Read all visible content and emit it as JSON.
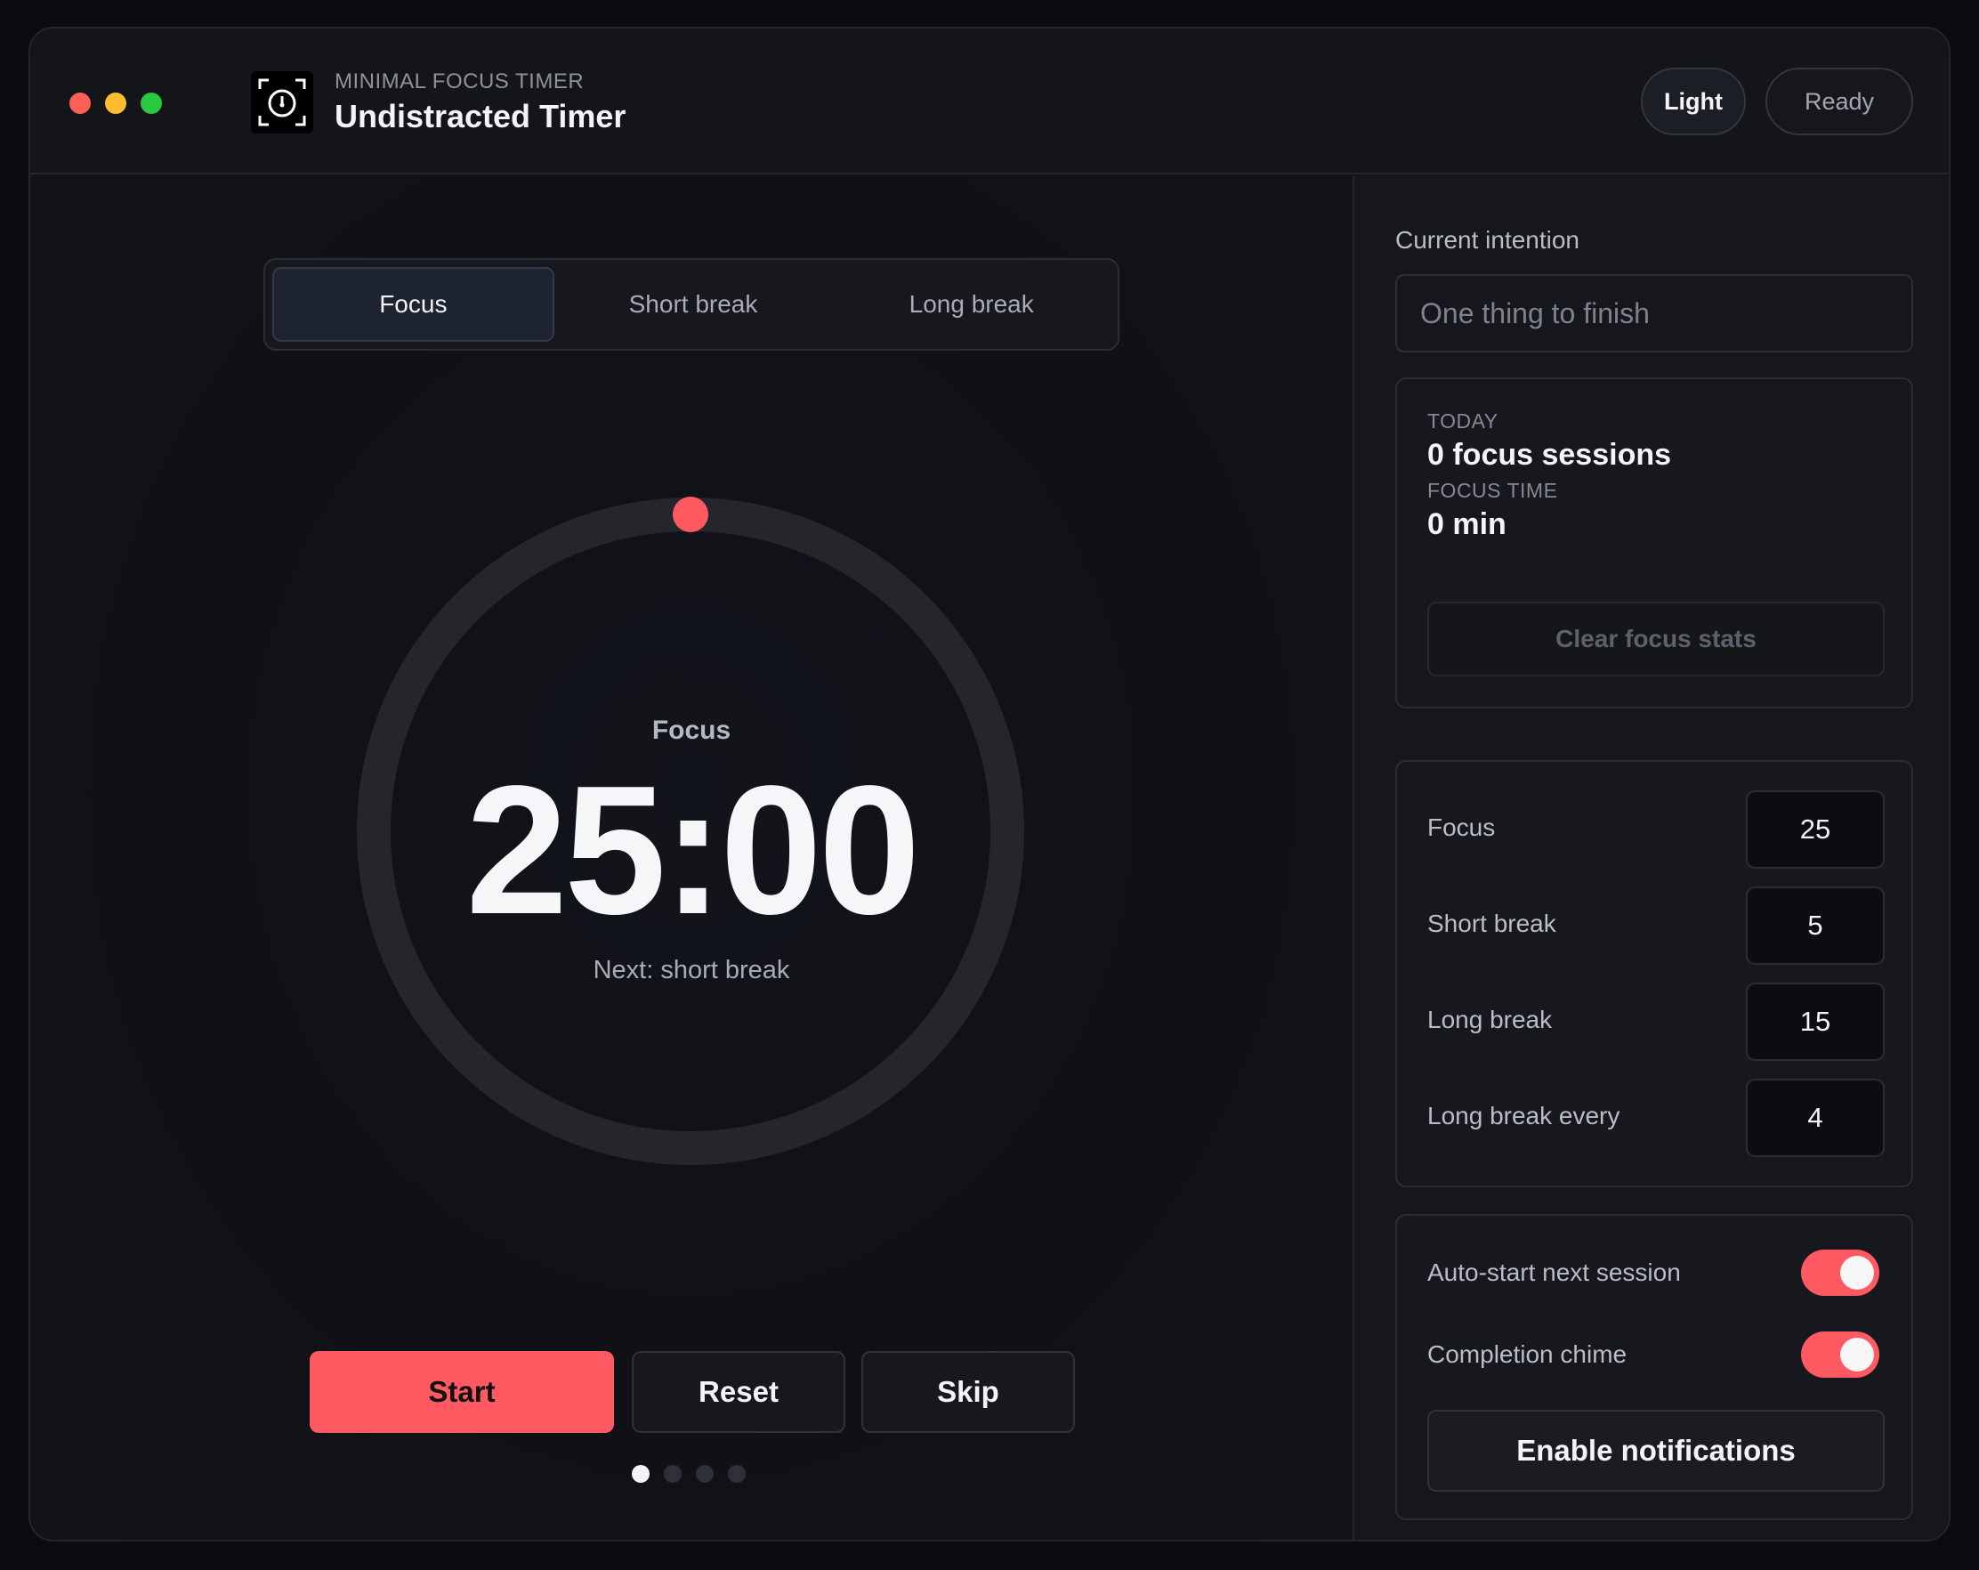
{
  "window": {
    "subtitle": "MINIMAL FOCUS TIMER",
    "title": "Undistracted Timer",
    "traffic_lights": [
      "#ff5f57",
      "#febc2e",
      "#28c840"
    ],
    "theme_button": "Light",
    "status": "Ready"
  },
  "modes": {
    "items": [
      {
        "label": "Focus",
        "active": true
      },
      {
        "label": "Short break",
        "active": false
      },
      {
        "label": "Long break",
        "active": false
      }
    ]
  },
  "timer": {
    "mode_label": "Focus",
    "time": "25:00",
    "next": "Next: short break",
    "progress": 0,
    "accent": "#ff5a62"
  },
  "controls": {
    "start": "Start",
    "reset": "Reset",
    "skip": "Skip"
  },
  "cycle": {
    "total": 4,
    "current": 1
  },
  "sidebar": {
    "intention_label": "Current intention",
    "intention_placeholder": "One thing to finish",
    "intention_value": "",
    "today": {
      "label": "TODAY",
      "sessions": "0 focus sessions",
      "focus_time_label": "FOCUS TIME",
      "focus_time": "0 min",
      "clear_button": "Clear focus stats"
    },
    "durations": [
      {
        "label": "Focus",
        "value": "25"
      },
      {
        "label": "Short break",
        "value": "5"
      },
      {
        "label": "Long break",
        "value": "15"
      },
      {
        "label": "Long break every",
        "value": "4"
      }
    ],
    "options": {
      "auto_start_label": "Auto-start next session",
      "auto_start": true,
      "chime_label": "Completion chime",
      "chime": true,
      "notify_button": "Enable notifications"
    }
  }
}
